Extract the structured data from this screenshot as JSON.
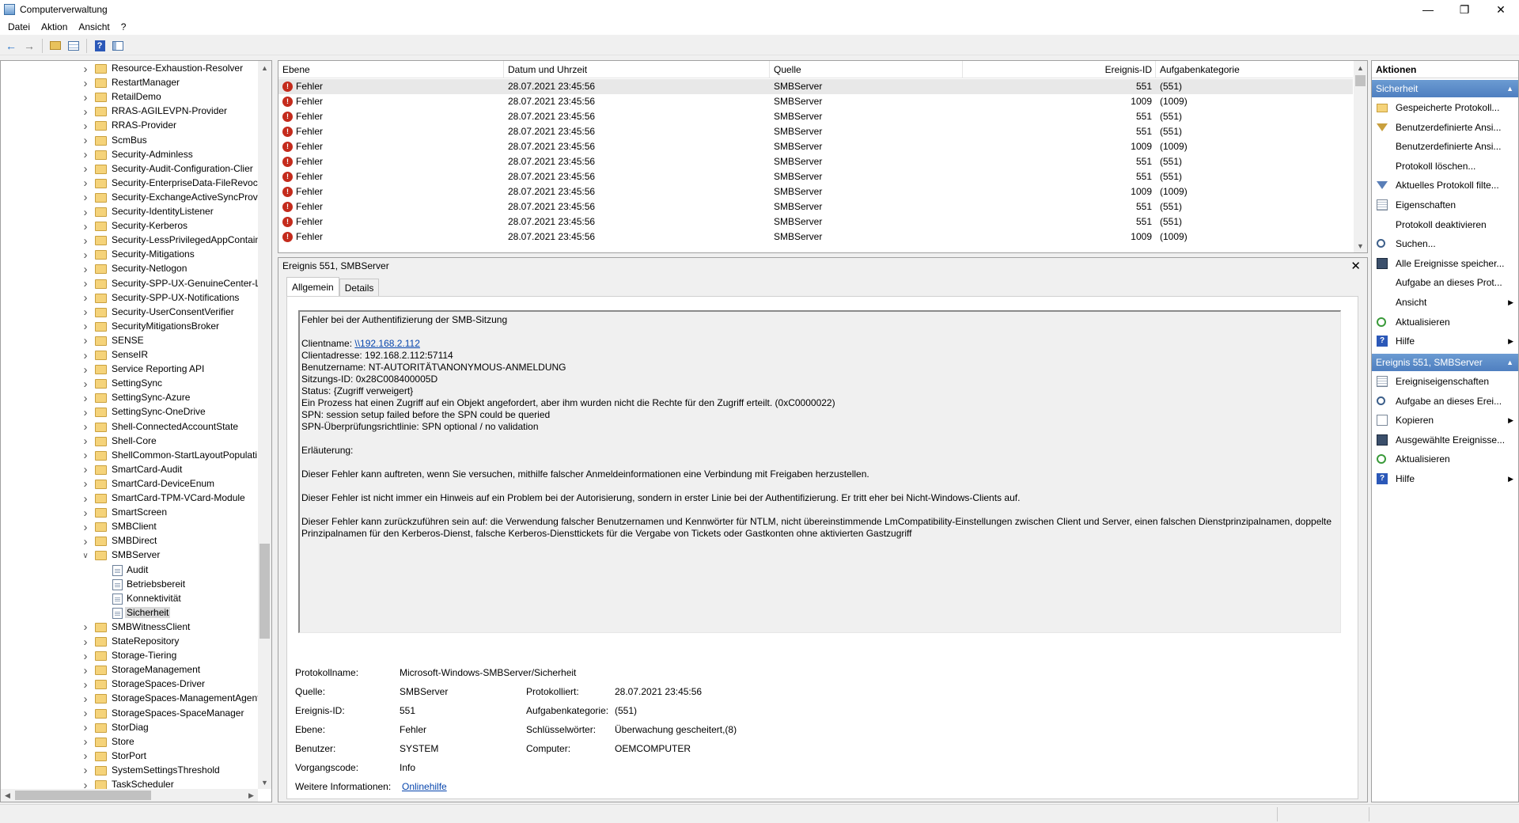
{
  "window": {
    "title": "Computerverwaltung",
    "controls": {
      "minimize": "—",
      "restore": "❐",
      "close": "✕"
    }
  },
  "menu": [
    "Datei",
    "Aktion",
    "Ansicht",
    "?"
  ],
  "toolbar": [
    "back-icon",
    "forward-icon",
    "up-folder-icon",
    "show-hide-tree-icon",
    "help-icon",
    "action-pane-icon"
  ],
  "tree": {
    "items": [
      {
        "label": "Resource-Exhaustion-Resolver",
        "expanded": false
      },
      {
        "label": "RestartManager",
        "expanded": false
      },
      {
        "label": "RetailDemo",
        "expanded": false
      },
      {
        "label": "RRAS-AGILEVPN-Provider",
        "expanded": false
      },
      {
        "label": "RRAS-Provider",
        "expanded": false
      },
      {
        "label": "ScmBus",
        "expanded": false
      },
      {
        "label": "Security-Adminless",
        "expanded": false
      },
      {
        "label": "Security-Audit-Configuration-Clier",
        "expanded": false
      },
      {
        "label": "Security-EnterpriseData-FileRevoca",
        "expanded": false
      },
      {
        "label": "Security-ExchangeActiveSyncProvis",
        "expanded": false
      },
      {
        "label": "Security-IdentityListener",
        "expanded": false
      },
      {
        "label": "Security-Kerberos",
        "expanded": false
      },
      {
        "label": "Security-LessPrivilegedAppContain",
        "expanded": false
      },
      {
        "label": "Security-Mitigations",
        "expanded": false
      },
      {
        "label": "Security-Netlogon",
        "expanded": false
      },
      {
        "label": "Security-SPP-UX-GenuineCenter-L",
        "expanded": false
      },
      {
        "label": "Security-SPP-UX-Notifications",
        "expanded": false
      },
      {
        "label": "Security-UserConsentVerifier",
        "expanded": false
      },
      {
        "label": "SecurityMitigationsBroker",
        "expanded": false
      },
      {
        "label": "SENSE",
        "expanded": false
      },
      {
        "label": "SenseIR",
        "expanded": false
      },
      {
        "label": "Service Reporting API",
        "expanded": false
      },
      {
        "label": "SettingSync",
        "expanded": false
      },
      {
        "label": "SettingSync-Azure",
        "expanded": false
      },
      {
        "label": "SettingSync-OneDrive",
        "expanded": false
      },
      {
        "label": "Shell-ConnectedAccountState",
        "expanded": false
      },
      {
        "label": "Shell-Core",
        "expanded": false
      },
      {
        "label": "ShellCommon-StartLayoutPopulati",
        "expanded": false
      },
      {
        "label": "SmartCard-Audit",
        "expanded": false
      },
      {
        "label": "SmartCard-DeviceEnum",
        "expanded": false
      },
      {
        "label": "SmartCard-TPM-VCard-Module",
        "expanded": false
      },
      {
        "label": "SmartScreen",
        "expanded": false
      },
      {
        "label": "SMBClient",
        "expanded": false
      },
      {
        "label": "SMBDirect",
        "expanded": false
      },
      {
        "label": "SMBServer",
        "expanded": true
      },
      {
        "label": "Audit",
        "child": true
      },
      {
        "label": "Betriebsbereit",
        "child": true
      },
      {
        "label": "Konnektivität",
        "child": true
      },
      {
        "label": "Sicherheit",
        "child": true,
        "selected": true
      },
      {
        "label": "SMBWitnessClient",
        "expanded": false
      },
      {
        "label": "StateRepository",
        "expanded": false
      },
      {
        "label": "Storage-Tiering",
        "expanded": false
      },
      {
        "label": "StorageManagement",
        "expanded": false
      },
      {
        "label": "StorageSpaces-Driver",
        "expanded": false
      },
      {
        "label": "StorageSpaces-ManagementAgent",
        "expanded": false
      },
      {
        "label": "StorageSpaces-SpaceManager",
        "expanded": false
      },
      {
        "label": "StorDiag",
        "expanded": false
      },
      {
        "label": "Store",
        "expanded": false
      },
      {
        "label": "StorPort",
        "expanded": false
      },
      {
        "label": "SystemSettingsThreshold",
        "expanded": false
      },
      {
        "label": "TaskScheduler",
        "expanded": false
      }
    ]
  },
  "events": {
    "columns": [
      "Ebene",
      "Datum und Uhrzeit",
      "Quelle",
      "Ereignis-ID",
      "Aufgabenkategorie"
    ],
    "rows": [
      {
        "level": "Fehler",
        "datetime": "28.07.2021 23:45:56",
        "source": "SMBServer",
        "id": "551",
        "category": "(551)"
      },
      {
        "level": "Fehler",
        "datetime": "28.07.2021 23:45:56",
        "source": "SMBServer",
        "id": "1009",
        "category": "(1009)"
      },
      {
        "level": "Fehler",
        "datetime": "28.07.2021 23:45:56",
        "source": "SMBServer",
        "id": "551",
        "category": "(551)"
      },
      {
        "level": "Fehler",
        "datetime": "28.07.2021 23:45:56",
        "source": "SMBServer",
        "id": "551",
        "category": "(551)"
      },
      {
        "level": "Fehler",
        "datetime": "28.07.2021 23:45:56",
        "source": "SMBServer",
        "id": "1009",
        "category": "(1009)"
      },
      {
        "level": "Fehler",
        "datetime": "28.07.2021 23:45:56",
        "source": "SMBServer",
        "id": "551",
        "category": "(551)"
      },
      {
        "level": "Fehler",
        "datetime": "28.07.2021 23:45:56",
        "source": "SMBServer",
        "id": "551",
        "category": "(551)"
      },
      {
        "level": "Fehler",
        "datetime": "28.07.2021 23:45:56",
        "source": "SMBServer",
        "id": "1009",
        "category": "(1009)"
      },
      {
        "level": "Fehler",
        "datetime": "28.07.2021 23:45:56",
        "source": "SMBServer",
        "id": "551",
        "category": "(551)"
      },
      {
        "level": "Fehler",
        "datetime": "28.07.2021 23:45:56",
        "source": "SMBServer",
        "id": "551",
        "category": "(551)"
      },
      {
        "level": "Fehler",
        "datetime": "28.07.2021 23:45:56",
        "source": "SMBServer",
        "id": "1009",
        "category": "(1009)"
      }
    ]
  },
  "detail": {
    "title": "Ereignis 551, SMBServer",
    "close": "✕",
    "tabs": [
      "Allgemein",
      "Details"
    ],
    "message": {
      "line1": "Fehler bei der Authentifizierung der SMB-Sitzung",
      "client_name_label": "Clientname: ",
      "client_name_link": "\\\\192.168.2.112",
      "client_address": "Clientadresse: 192.168.2.112:57114",
      "user": "Benutzername: NT-AUTORITÄT\\ANONYMOUS-ANMELDUNG",
      "session": "Sitzungs-ID: 0x28C008400005D",
      "status": "Status: {Zugriff verweigert}",
      "process": "Ein Prozess hat einen Zugriff auf ein Objekt angefordert, aber ihm wurden nicht die Rechte für den Zugriff erteilt. (0xC0000022)",
      "spn": "SPN: session setup failed before the SPN could be queried",
      "spn_policy": "SPN-Überprüfungsrichtlinie: SPN optional / no validation",
      "explanation": "Erläuterung:",
      "para1": "Dieser Fehler kann auftreten, wenn Sie versuchen, mithilfe falscher Anmeldeinformationen eine Verbindung mit Freigaben herzustellen.",
      "para2": "Dieser Fehler ist nicht immer ein Hinweis auf ein Problem bei der Autorisierung, sondern in erster Linie bei der Authentifizierung. Er tritt eher bei Nicht-Windows-Clients auf.",
      "para3a": "Dieser Fehler kann zurückzuführen sein auf: die Verwendung falscher Benutzernamen und Kennwörter für NTLM, nicht übereinstimmende LmCompatibility-Einstellungen zwischen Client und Server, einen falschen Dienstprinzipalnamen, doppelte",
      "para3b": "Prinzipalnamen für den Kerberos-Dienst, falsche Kerberos-Diensttickets für die Vergabe von Tickets oder Gastkonten ohne aktivierten Gastzugriff"
    },
    "props": {
      "log_name_label": "Protokollname:",
      "log_name": "Microsoft-Windows-SMBServer/Sicherheit",
      "source_label": "Quelle:",
      "source": "SMBServer",
      "logged_label": "Protokolliert:",
      "logged": "28.07.2021 23:45:56",
      "event_id_label": "Ereignis-ID:",
      "event_id": "551",
      "task_label": "Aufgabenkategorie:",
      "task": "(551)",
      "level_label": "Ebene:",
      "level": "Fehler",
      "keywords_label": "Schlüsselwörter:",
      "keywords": "Überwachung gescheitert,(8)",
      "user_label": "Benutzer:",
      "user": "SYSTEM",
      "computer_label": "Computer:",
      "computer": "OEMCOMPUTER",
      "opcode_label": "Vorgangscode:",
      "opcode": "Info",
      "more_info_label": "Weitere Informationen:",
      "more_info_link": "Onlinehilfe"
    }
  },
  "actions": {
    "title": "Aktionen",
    "group1": "Sicherheit",
    "group1_items": [
      {
        "label": "Gespeicherte Protokoll...",
        "icon": "open-saved-log-icon"
      },
      {
        "label": "Benutzerdefinierte Ansi...",
        "icon": "create-custom-view-icon"
      },
      {
        "label": "Benutzerdefinierte Ansi...",
        "icon": ""
      },
      {
        "label": "Protokoll löschen...",
        "icon": ""
      },
      {
        "label": "Aktuelles Protokoll filte...",
        "icon": "filter-icon"
      },
      {
        "label": "Eigenschaften",
        "icon": "properties-icon"
      },
      {
        "label": "Protokoll deaktivieren",
        "icon": ""
      },
      {
        "label": "Suchen...",
        "icon": "find-icon"
      },
      {
        "label": "Alle Ereignisse speicher...",
        "icon": "save-icon"
      },
      {
        "label": "Aufgabe an dieses Prot...",
        "icon": ""
      },
      {
        "label": "Ansicht",
        "icon": "",
        "submenu": true
      },
      {
        "label": "Aktualisieren",
        "icon": "refresh-icon"
      },
      {
        "label": "Hilfe",
        "icon": "help-icon",
        "submenu": true
      }
    ],
    "group2": "Ereignis 551, SMBServer",
    "group2_items": [
      {
        "label": "Ereigniseigenschaften",
        "icon": "event-properties-icon"
      },
      {
        "label": "Aufgabe an dieses Erei...",
        "icon": "attach-task-icon"
      },
      {
        "label": "Kopieren",
        "icon": "copy-icon",
        "submenu": true
      },
      {
        "label": "Ausgewählte Ereignisse...",
        "icon": "save-icon"
      },
      {
        "label": "Aktualisieren",
        "icon": "refresh-icon"
      },
      {
        "label": "Hilfe",
        "icon": "help-icon",
        "submenu": true
      }
    ]
  }
}
